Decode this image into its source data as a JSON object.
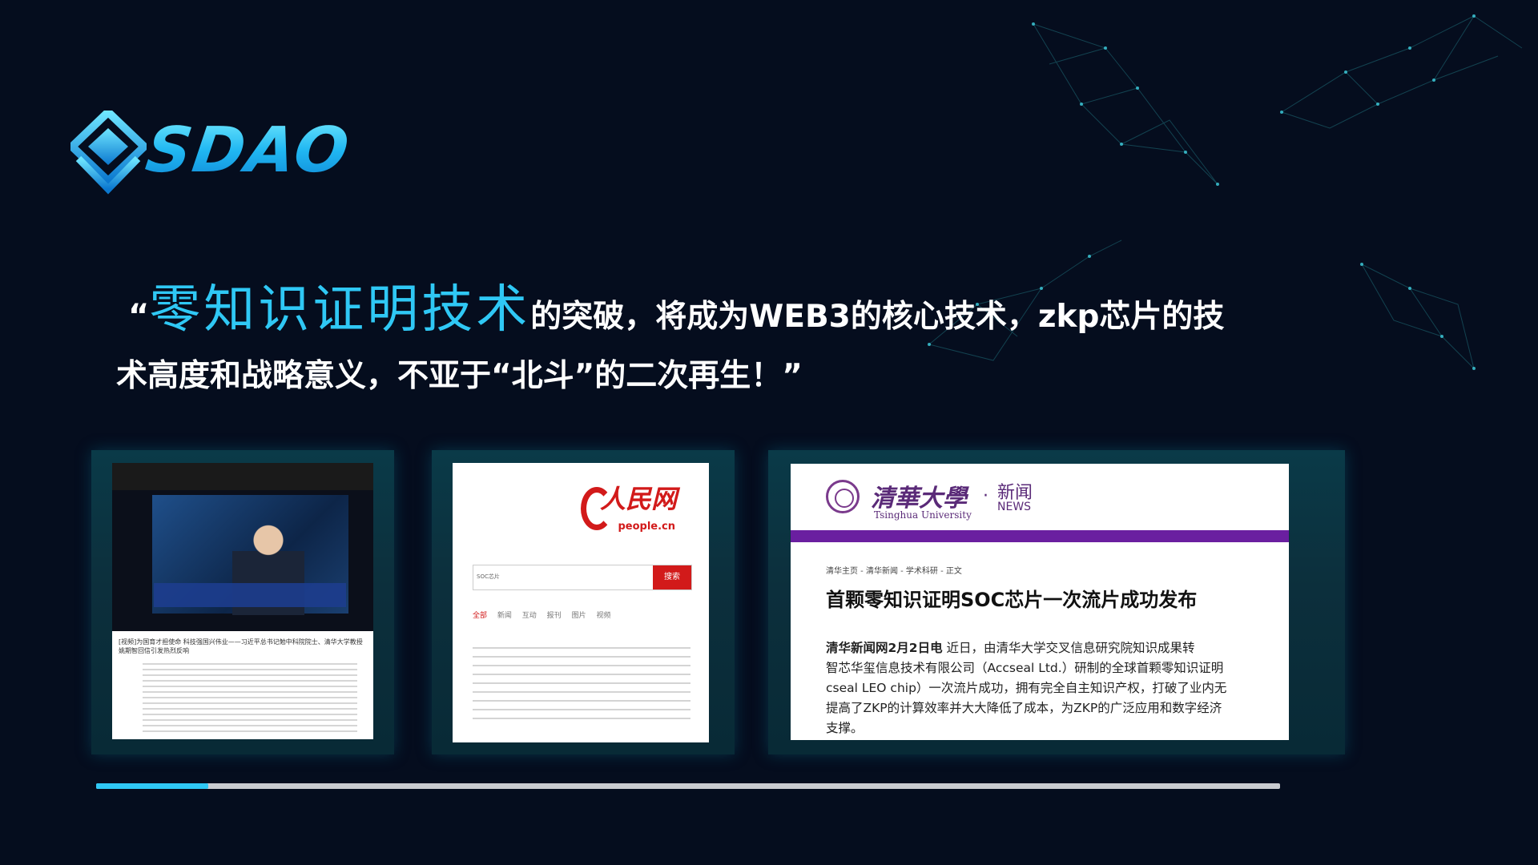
{
  "brand": {
    "name": "SDAO"
  },
  "quote": {
    "open_mark": "“",
    "highlight": "零知识证明技术",
    "line1_rest": "的突破，将成为WEB3的核心技术，zkp芯片的技",
    "line2": "术高度和战略意义，不亚于“北斗”的二次再生！”"
  },
  "images": {
    "cctv": {
      "headline": "[视频]为国育才担使命 科技强国兴伟业——习近平总书记勉中科院院士、清华大学教授姚期智回信引发热烈反响"
    },
    "people": {
      "logo_text": "人民网",
      "domain": "people.cn",
      "search_query": "SOC芯片",
      "search_button": "搜索",
      "tabs": [
        "全部",
        "新闻",
        "互动",
        "报刊",
        "图片",
        "视频"
      ]
    },
    "tsinghua": {
      "school_name": "清華大學",
      "school_name_en": "Tsinghua University",
      "dot": "·",
      "section": "新闻",
      "section_en": "NEWS",
      "breadcrumb": "清华主页 - 清华新闻 - 学术科研 - 正文",
      "title": "首颗零知识证明SOC芯片一次流片成功发布",
      "body_lead": "清华新闻网2月2日电",
      "body_rest": " 近日，由清华大学交叉信息研究院知识成果转",
      "body_lines": [
        "智芯华玺信息技术有限公司（Accseal Ltd.）研制的全球首颗零知识证明",
        "cseal LEO chip）一次流片成功，拥有完全自主知识产权，打破了业内无",
        "提高了ZKP的计算效率并大大降低了成本，为ZKP的广泛应用和数字经济",
        "支撑。"
      ]
    }
  },
  "progress": {
    "value": 0.095
  },
  "colors": {
    "background": "#050d1e",
    "accent": "#2fc8f5",
    "panel": "#0a3a48",
    "tsinghua_purple": "#6a1fa0",
    "people_red": "#d21a1a"
  }
}
